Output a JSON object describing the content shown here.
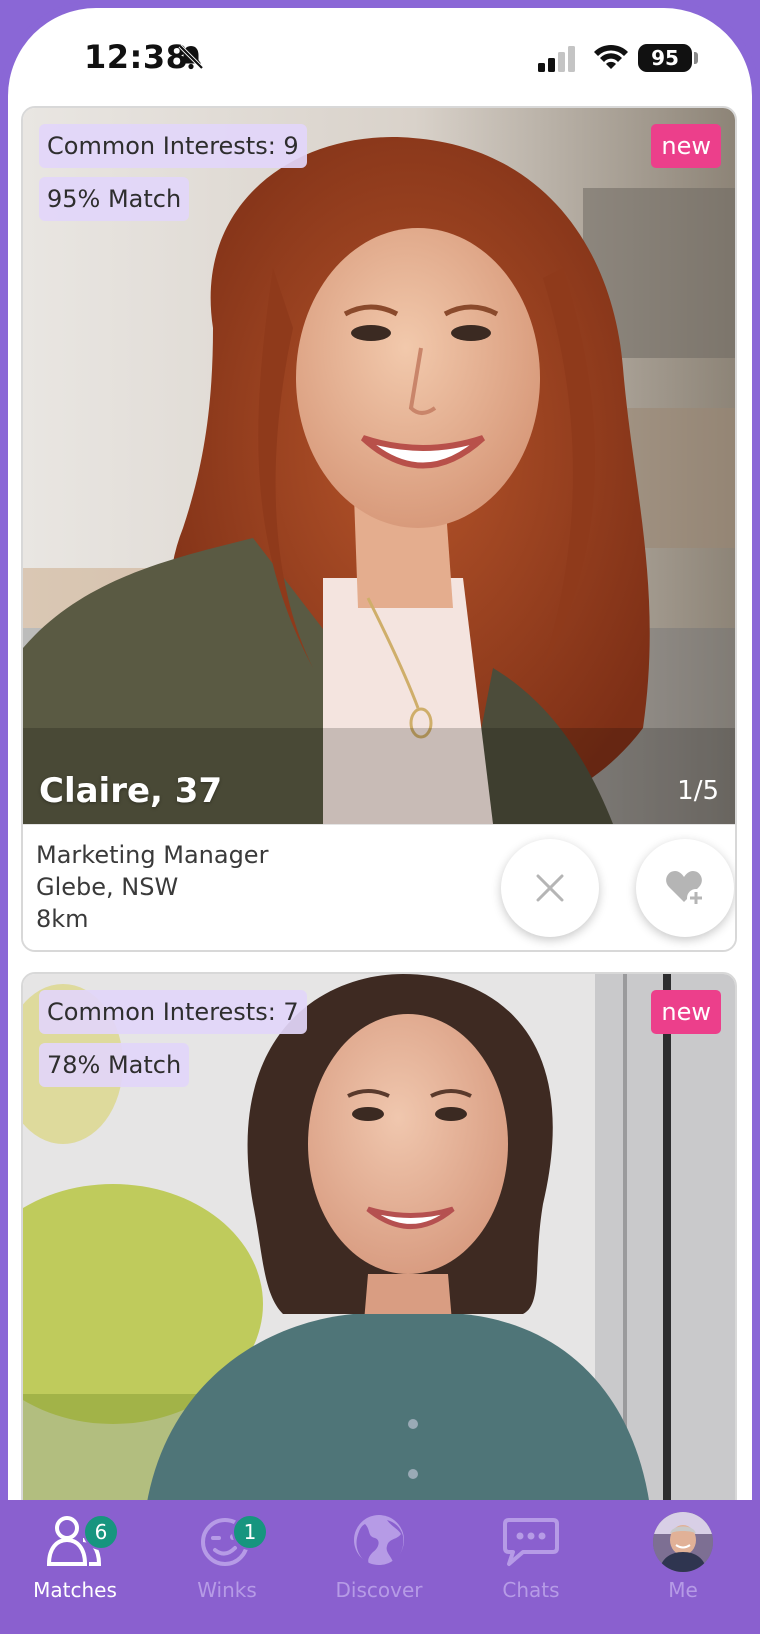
{
  "status_bar": {
    "time": "12:38",
    "battery": "95"
  },
  "cards": [
    {
      "common_interests": "Common Interests: 9",
      "match": "95% Match",
      "badge": "new",
      "name_age": "Claire, 37",
      "photo_count": "1/5",
      "job": "Marketing Manager",
      "location": "Glebe, NSW",
      "distance": "8km"
    },
    {
      "common_interests": "Common Interests: 7",
      "match": "78% Match",
      "badge": "new"
    }
  ],
  "tabs": [
    {
      "label": "Matches",
      "badge": "6",
      "icon": "matches-icon",
      "active": true
    },
    {
      "label": "Winks",
      "badge": "1",
      "icon": "wink-icon",
      "active": false
    },
    {
      "label": "Discover",
      "icon": "globe-icon",
      "active": false
    },
    {
      "label": "Chats",
      "icon": "chat-icon",
      "active": false
    },
    {
      "label": "Me",
      "icon": "avatar",
      "active": false
    }
  ],
  "colors": {
    "accent": "#8a60cf",
    "new_badge": "#ec3f8b",
    "tab_badge": "#17957f",
    "chip": "#e2d6fa"
  }
}
